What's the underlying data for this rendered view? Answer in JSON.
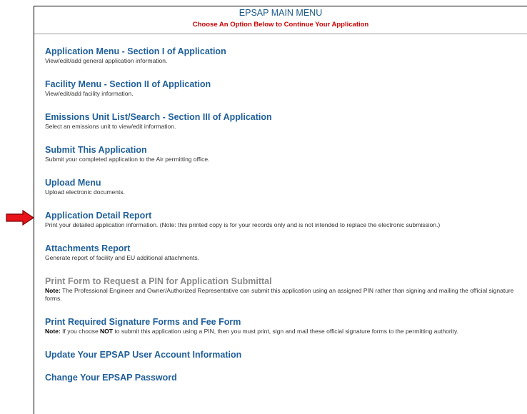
{
  "header": {
    "title": "EPSAP MAIN MENU",
    "subtitle": "Choose An Option Below to Continue Your Application"
  },
  "menu": [
    {
      "label": "Application Menu - Section I of Application",
      "desc": "View/edit/add general application information."
    },
    {
      "label": "Facility Menu - Section II of Application",
      "desc": "View/edit/add facility information."
    },
    {
      "label": "Emissions Unit List/Search - Section III of Application",
      "desc": "Select an emissions unit to view/edit information."
    },
    {
      "label": "Submit This Application",
      "desc": "Submit your completed application to the Air permitting office."
    },
    {
      "label": "Upload Menu",
      "desc": "Upload electronic documents."
    },
    {
      "label": "Application Detail Report",
      "desc": "Print your detailed application information. (Note: this printed copy is for your records only and is not intended to replace the electronic submission.)"
    },
    {
      "label": "Attachments Report",
      "desc": "Generate report of facility and EU additional attachments."
    },
    {
      "label": "Print Form to Request a PIN for Application Submittal",
      "note_prefix": "Note:",
      "desc": "The Professional Engineer and Owner/Authorized Representative can submit this application using an assigned PIN rather than signing and mailing the official signature forms."
    },
    {
      "label": "Print Required Signature Forms and Fee Form",
      "note_prefix": "Note:",
      "desc_a": "If you choose",
      "desc_bold": "NOT",
      "desc_b": "to submit this application using a PIN, then you must print, sign and mail these official signature forms to the permitting authority."
    },
    {
      "label": "Update Your EPSAP User Account Information"
    },
    {
      "label": "Change Your EPSAP Password"
    }
  ],
  "annotation": {
    "icon": "arrow-right-icon",
    "color": "#e8141a",
    "points_to": "Application Detail Report"
  }
}
